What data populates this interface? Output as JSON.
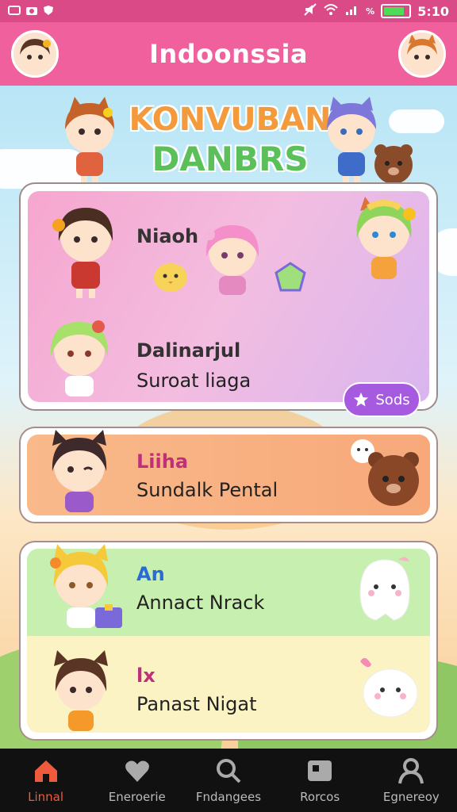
{
  "status_bar": {
    "left_icons": [
      "message-icon",
      "camera-icon",
      "shield-icon"
    ],
    "signal_text": "%",
    "battery_level": 0.85,
    "time": "5:10"
  },
  "header": {
    "title": "Indoonssia"
  },
  "banner": {
    "line1": "KONVUBAN",
    "line2": "DANBRS"
  },
  "cards": {
    "pink": {
      "name1": "Niaoh",
      "name2": "Dalinarjul",
      "sub": "Suroat liaga",
      "badge_label": "Sods"
    },
    "orange": {
      "name": "Liiha",
      "sub": "Sundalk Pental"
    },
    "green": {
      "name": "An",
      "sub": "Annact Nrack"
    },
    "yellow": {
      "name": "lx",
      "sub": "Panast Nigat"
    }
  },
  "nav": {
    "items": [
      {
        "label": "Linnal",
        "icon": "home-icon",
        "active": true
      },
      {
        "label": "Eneroerie",
        "icon": "heart-icon",
        "active": false
      },
      {
        "label": "Fndangees",
        "icon": "search-icon",
        "active": false
      },
      {
        "label": "Rorcos",
        "icon": "gallery-icon",
        "active": false
      },
      {
        "label": "Egnereoy",
        "icon": "profile-icon",
        "active": false
      }
    ]
  },
  "colors": {
    "accent": "#f0609d",
    "badge": "#a65ae0",
    "active_nav": "#f05a3c"
  }
}
